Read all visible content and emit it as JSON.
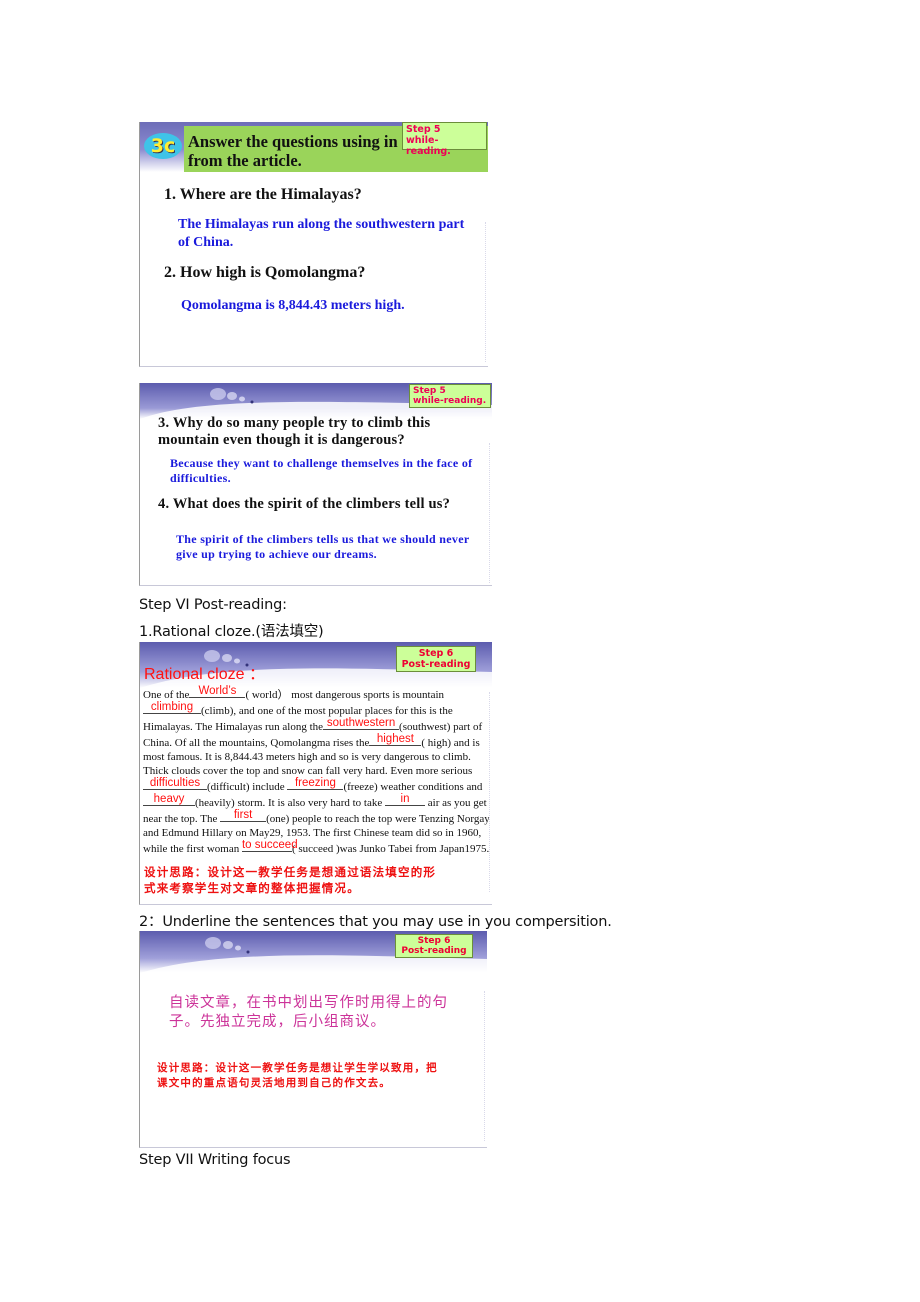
{
  "slide1": {
    "badge": "3c",
    "title": "Answer the questions using in from the article.",
    "title_line1": "Answer the questions using in",
    "title_line2": "from the article.",
    "step_line1": "Step 5",
    "step_line2": "while-reading.",
    "q1": "1. Where are the Himalayas?",
    "a1": "The Himalayas run along the southwestern part of China.",
    "q2": "2. How high is Qomolangma?",
    "a2": "Qomolangma is 8,844.43 meters high."
  },
  "slide2": {
    "step_line1": "Step 5",
    "step_line2": "while-reading.",
    "q3": "3. Why do so many people try to climb this mountain even though it is dangerous?",
    "a3": "Because they want to challenge themselves in the face of difficulties.",
    "q4": "4. What does the spirit of the climbers tell us?",
    "a4": "The spirit of the climbers tells us that we should never give up trying to achieve our dreams."
  },
  "doc": {
    "step6_heading": "Step VI Post-reading:",
    "cloze_heading": "1.Rational cloze.(语法填空)",
    "underline_heading": "2：Underline the sentences that you may use in you compersition.",
    "step7_heading": "Step VII Writing focus"
  },
  "slide3": {
    "title": "Rational cloze ：",
    "step_line1": "Step 6",
    "step_line2": "Post-reading",
    "text": {
      "t1": "One of the",
      "b1": "World’s",
      "t2": "( world） most dangerous sports is mountain",
      "b2": "climbing",
      "t3": "(climb), and one of  the most popular places for this is the Himalayas. The Himalayas run along the",
      "b3": "southwestern",
      "t4": "(southwest) part of China. Of all the mountains, Qomolangma  rises the",
      "b4": "highest",
      "t5": "( high) and is  most famous. It is 8,844.43 meters high and so is very dangerous  to climb. Thick clouds cover the top and snow can fall very hard. Even more serious",
      "b5": "difficulties",
      "t6": "(difficult) include",
      "b6": "freezing",
      "t7": "(freeze) weather conditions and",
      "b7": "heavy",
      "t8": "(heavily) storm. It is also very hard to take",
      "b8": "in",
      "t9": "air as you get near the top. The",
      "b9": "first",
      "t10": "(one) people to reach the top were Tenzing Norgay and Edmund Hillary on May29, 1953. The first Chinese team did so in 1960, while the first woman",
      "b10": "to succeed",
      "t11": "( succeed )was Junko Tabei  from Japan1975."
    },
    "design_note": "设计思路：设计这一教学任务是想通过语法填空的形式来考察学生对文章的整体把握情况。"
  },
  "slide4": {
    "step_line1": "Step 6",
    "step_line2": "Post-reading",
    "task": "自读文章，在书中划出写作时用得上的句子。先独立完成，后小组商议。",
    "design_note": "设计思路：设计这一教学任务是想让学生学以致用，把课文中的重点语句灵活地用到自己的作文去。"
  },
  "colors": {
    "answer_blue": "#1a1adc",
    "cloze_red": "#ff1111",
    "step_badge_bg": "#ccff99",
    "step_badge_text": "#ee0055",
    "header_green": "#9ad45a",
    "task_pink": "#cc3399"
  }
}
